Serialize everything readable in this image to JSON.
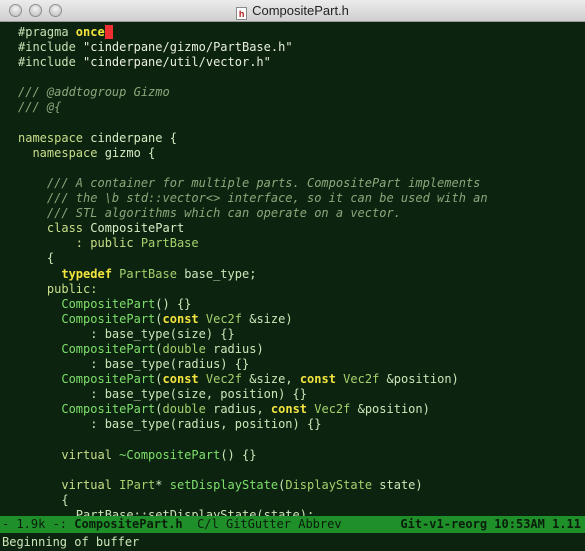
{
  "window": {
    "title": "CompositePart.h",
    "file_icon_letter": "h"
  },
  "code_lines": [
    [
      {
        "t": "#pragma ",
        "c": "t-pre"
      },
      {
        "t": "once",
        "c": "t-kw2"
      }
    ],
    [
      {
        "t": "#include ",
        "c": "t-pre"
      },
      {
        "t": "\"cinderpane/gizmo/PartBase.h\"",
        "c": "t-str"
      }
    ],
    [
      {
        "t": "#include ",
        "c": "t-pre"
      },
      {
        "t": "\"cinderpane/util/vector.h\"",
        "c": "t-str"
      }
    ],
    [],
    [
      {
        "t": "/// @addtogroup Gizmo",
        "c": "t-com"
      }
    ],
    [
      {
        "t": "/// @{",
        "c": "t-com"
      }
    ],
    [],
    [
      {
        "t": "namespace ",
        "c": "t-kw"
      },
      {
        "t": "cinderpane {",
        "c": "t-ns"
      }
    ],
    [
      {
        "t": "  namespace ",
        "c": "t-kw"
      },
      {
        "t": "gizmo {",
        "c": "t-ns"
      }
    ],
    [],
    [
      {
        "t": "    /// A container for multiple parts. CompositePart implements",
        "c": "t-com"
      }
    ],
    [
      {
        "t": "    /// the \\b std::vector<> interface, so it can be used with an",
        "c": "t-com"
      }
    ],
    [
      {
        "t": "    /// STL algorithms which can operate on a vector.",
        "c": "t-com"
      }
    ],
    [
      {
        "t": "    class ",
        "c": "t-kw"
      },
      {
        "t": "CompositePart",
        "c": "t-ns"
      }
    ],
    [
      {
        "t": "        : public ",
        "c": "t-kw"
      },
      {
        "t": "PartBase",
        "c": "t-type"
      }
    ],
    [
      {
        "t": "    {",
        "c": "t-plain"
      }
    ],
    [
      {
        "t": "      typedef ",
        "c": "t-kw2"
      },
      {
        "t": "PartBase ",
        "c": "t-type"
      },
      {
        "t": "base_type;",
        "c": "t-plain"
      }
    ],
    [
      {
        "t": "    public:",
        "c": "t-kw"
      }
    ],
    [
      {
        "t": "      CompositePart",
        "c": "t-fn"
      },
      {
        "t": "() {}",
        "c": "t-plain"
      }
    ],
    [
      {
        "t": "      CompositePart",
        "c": "t-fn"
      },
      {
        "t": "(",
        "c": "t-plain"
      },
      {
        "t": "const ",
        "c": "t-kw2"
      },
      {
        "t": "Vec2f ",
        "c": "t-type"
      },
      {
        "t": "&size)",
        "c": "t-plain"
      }
    ],
    [
      {
        "t": "          : base_type(size) {}",
        "c": "t-plain"
      }
    ],
    [
      {
        "t": "      CompositePart",
        "c": "t-fn"
      },
      {
        "t": "(",
        "c": "t-plain"
      },
      {
        "t": "double ",
        "c": "t-type"
      },
      {
        "t": "radius)",
        "c": "t-plain"
      }
    ],
    [
      {
        "t": "          : base_type(radius) {}",
        "c": "t-plain"
      }
    ],
    [
      {
        "t": "      CompositePart",
        "c": "t-fn"
      },
      {
        "t": "(",
        "c": "t-plain"
      },
      {
        "t": "const ",
        "c": "t-kw2"
      },
      {
        "t": "Vec2f ",
        "c": "t-type"
      },
      {
        "t": "&size, ",
        "c": "t-plain"
      },
      {
        "t": "const ",
        "c": "t-kw2"
      },
      {
        "t": "Vec2f ",
        "c": "t-type"
      },
      {
        "t": "&position)",
        "c": "t-plain"
      }
    ],
    [
      {
        "t": "          : base_type(size, position) {}",
        "c": "t-plain"
      }
    ],
    [
      {
        "t": "      CompositePart",
        "c": "t-fn"
      },
      {
        "t": "(",
        "c": "t-plain"
      },
      {
        "t": "double ",
        "c": "t-type"
      },
      {
        "t": "radius, ",
        "c": "t-plain"
      },
      {
        "t": "const ",
        "c": "t-kw2"
      },
      {
        "t": "Vec2f ",
        "c": "t-type"
      },
      {
        "t": "&position)",
        "c": "t-plain"
      }
    ],
    [
      {
        "t": "          : base_type(radius, position) {}",
        "c": "t-plain"
      }
    ],
    [],
    [
      {
        "t": "      virtual ",
        "c": "t-kw"
      },
      {
        "t": "~CompositePart",
        "c": "t-fn"
      },
      {
        "t": "() {}",
        "c": "t-plain"
      }
    ],
    [],
    [
      {
        "t": "      virtual ",
        "c": "t-kw"
      },
      {
        "t": "IPart",
        "c": "t-type"
      },
      {
        "t": "* ",
        "c": "t-plain"
      },
      {
        "t": "setDisplayState",
        "c": "t-fn"
      },
      {
        "t": "(",
        "c": "t-plain"
      },
      {
        "t": "DisplayState ",
        "c": "t-type"
      },
      {
        "t": "state)",
        "c": "t-plain"
      }
    ],
    [
      {
        "t": "      {",
        "c": "t-plain"
      }
    ],
    [
      {
        "t": "        PartBase::setDisplayState(state);",
        "c": "t-plain"
      }
    ]
  ],
  "modeline": {
    "status": "- 1.9k -: ",
    "buffer": "CompositePart.h",
    "modes": "  C/l GitGutter Abbrev",
    "right": "Git-v1-reorg 10:53AM 1.11"
  },
  "minibuffer": {
    "message": "Beginning of buffer"
  },
  "colors": {
    "background": "#0c2310",
    "modeline": "#1f8f2a",
    "cursor": "#f03030"
  }
}
